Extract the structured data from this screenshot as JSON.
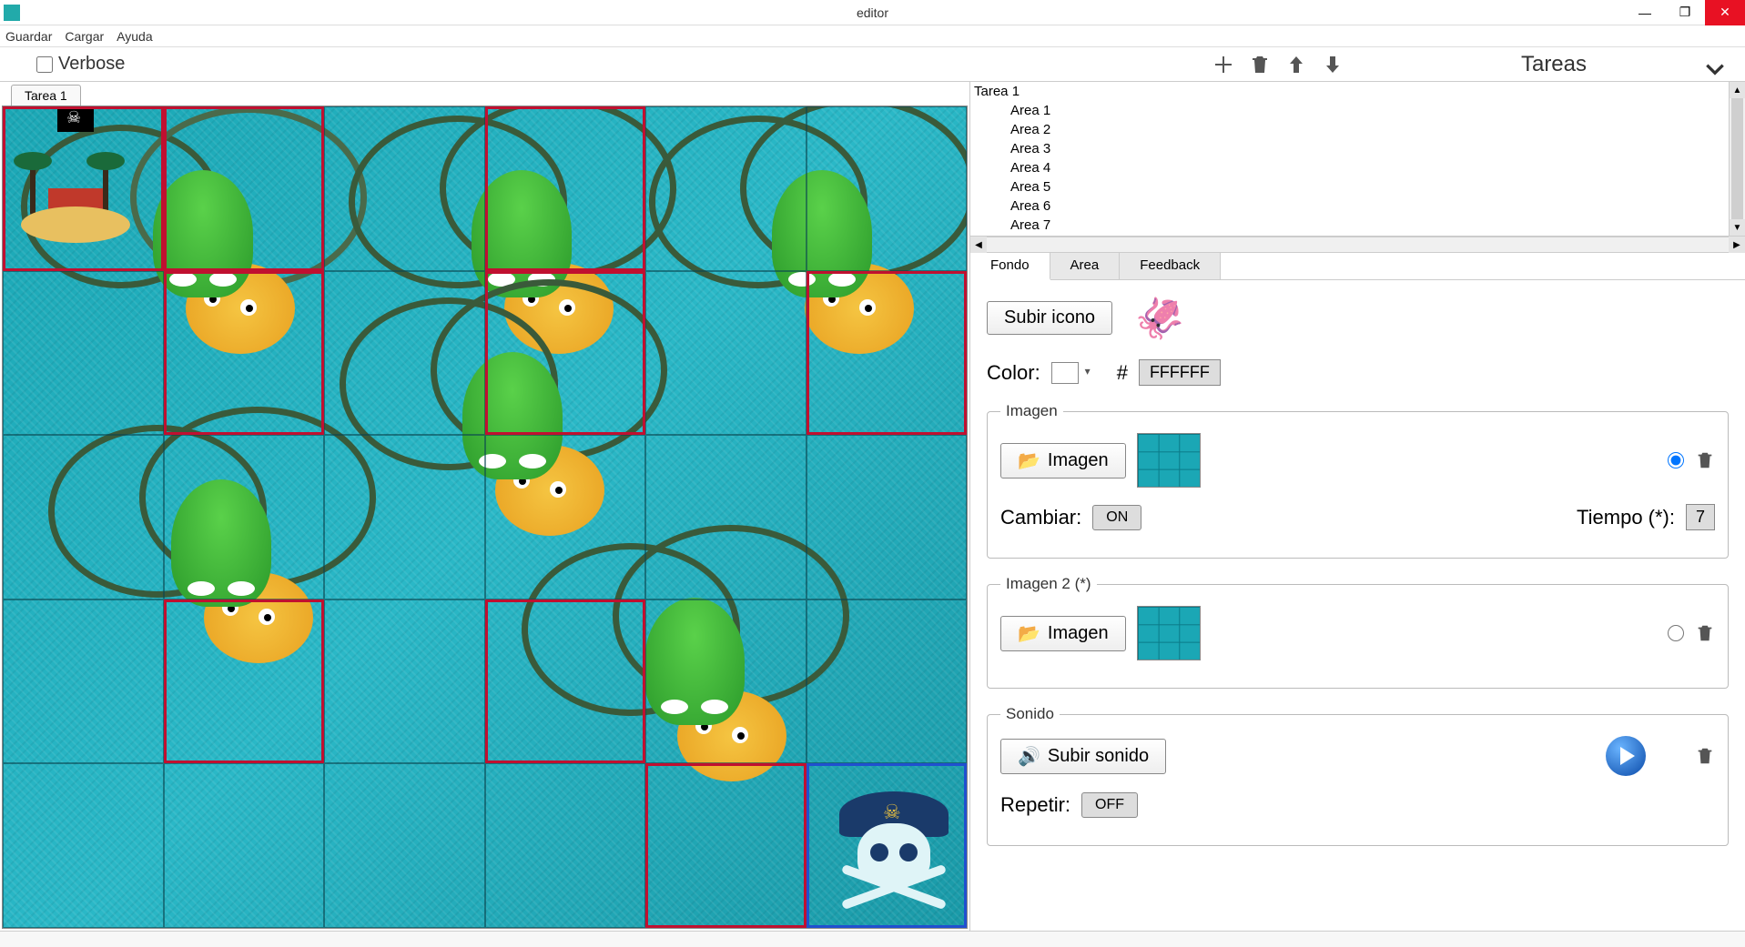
{
  "window": {
    "title": "editor"
  },
  "menu": {
    "guardar": "Guardar",
    "cargar": "Cargar",
    "ayuda": "Ayuda"
  },
  "toolbar": {
    "verbose_label": "Verbose",
    "tareas_title": "Tareas"
  },
  "canvas_tab": "Tarea 1",
  "tree": {
    "root": "Tarea 1",
    "children": [
      "Area 1",
      "Area 2",
      "Area 3",
      "Area 4",
      "Area 5",
      "Area 6",
      "Area 7"
    ]
  },
  "tabs": {
    "fondo": "Fondo",
    "area": "Area",
    "feedback": "Feedback"
  },
  "panel": {
    "subir_icono": "Subir icono",
    "color_label": "Color:",
    "hash": "#",
    "hex": "FFFFFF",
    "grp_imagen": "Imagen",
    "imagen_btn": "Imagen",
    "cambiar_label": "Cambiar:",
    "cambiar_value": "ON",
    "tiempo_label": "Tiempo (*):",
    "tiempo_value": "7",
    "grp_imagen2": "Imagen 2 (*)",
    "grp_sonido": "Sonido",
    "subir_sonido": "Subir sonido",
    "repetir_label": "Repetir:",
    "repetir_value": "OFF"
  },
  "grid": {
    "cols": 6,
    "rows": 5,
    "selected_red": [
      [
        0,
        0
      ],
      [
        1,
        0
      ],
      [
        3,
        0
      ],
      [
        1,
        1
      ],
      [
        3,
        1
      ],
      [
        5,
        1
      ],
      [
        1,
        3
      ],
      [
        3,
        3
      ],
      [
        4,
        4
      ]
    ],
    "selected_blue": [
      [
        5,
        4
      ]
    ]
  }
}
